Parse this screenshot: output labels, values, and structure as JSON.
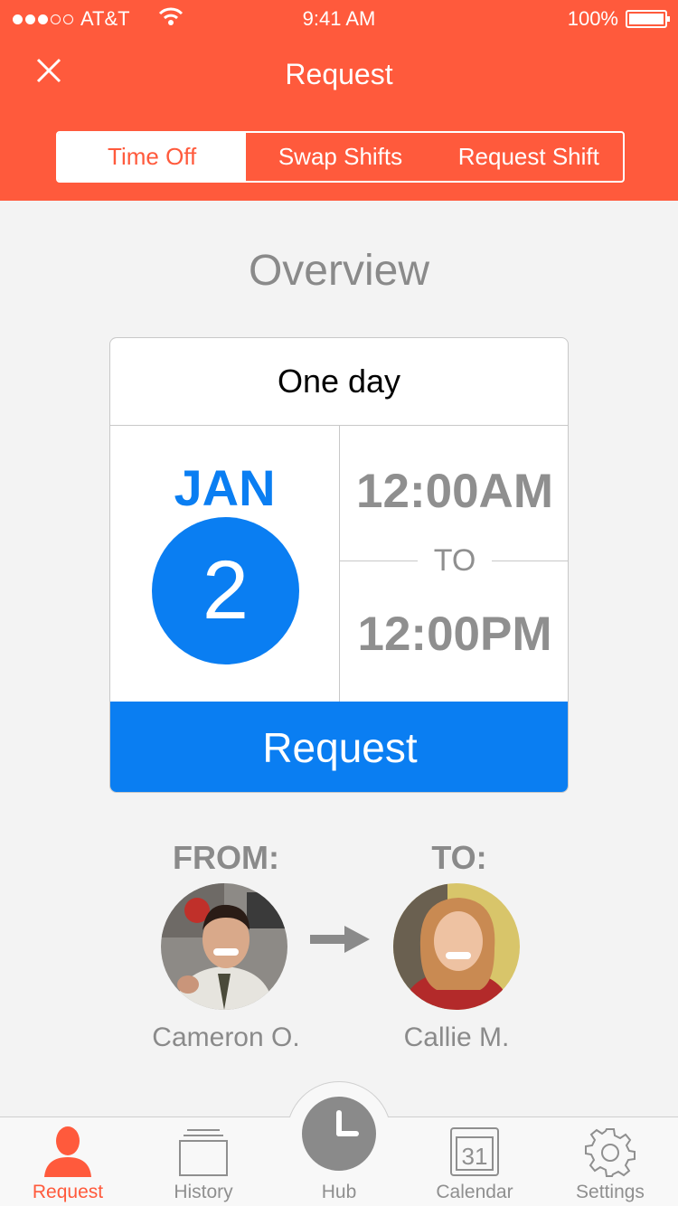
{
  "status_bar": {
    "carrier": "AT&T",
    "time": "9:41 AM",
    "battery": "100%"
  },
  "header": {
    "title": "Request"
  },
  "segments": [
    {
      "label": "Time Off",
      "active": true
    },
    {
      "label": "Swap Shifts",
      "active": false
    },
    {
      "label": "Request Shift",
      "active": false
    }
  ],
  "overview": {
    "heading": "Overview",
    "duration": "One day",
    "month": "JAN",
    "day": "2",
    "start_time": "12:00AM",
    "to_label": "TO",
    "end_time": "12:00PM",
    "request_button": "Request"
  },
  "transfer": {
    "from_label": "FROM:",
    "to_label": "TO:",
    "from_name": "Cameron O.",
    "to_name": "Callie M."
  },
  "tabbar": {
    "items": [
      {
        "label": "Request",
        "icon": "person-icon",
        "active": true
      },
      {
        "label": "History",
        "icon": "history-icon",
        "active": false
      },
      {
        "label": "Hub",
        "icon": "clock-icon",
        "active": false
      },
      {
        "label": "Calendar",
        "icon": "calendar-icon",
        "active": false,
        "calendar_day": "31"
      },
      {
        "label": "Settings",
        "icon": "gear-icon",
        "active": false
      }
    ]
  },
  "colors": {
    "accent": "#ff5a3c",
    "primary_blue": "#0a7ef2",
    "gray_text": "#8a8a8a"
  }
}
